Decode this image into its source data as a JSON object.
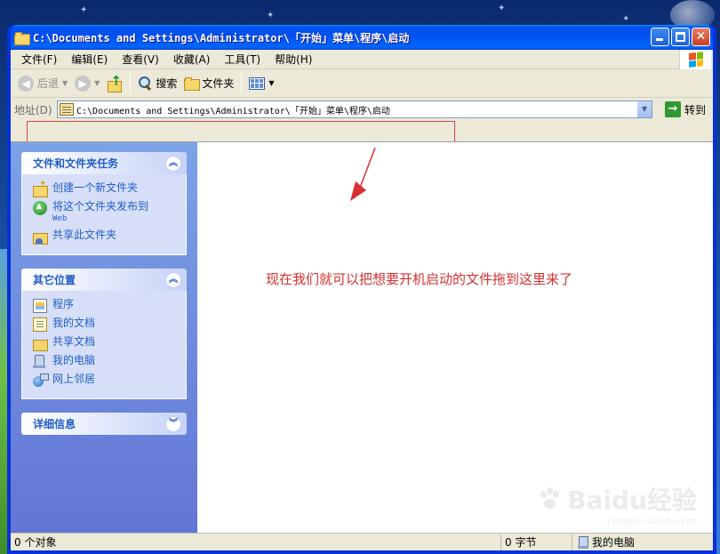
{
  "window": {
    "title": "C:\\Documents and Settings\\Administrator\\「开始」菜单\\程序\\启动"
  },
  "menu": [
    "文件(F)",
    "编辑(E)",
    "查看(V)",
    "收藏(A)",
    "工具(T)",
    "帮助(H)"
  ],
  "toolbar": {
    "back_label": "后退",
    "search_label": "搜索",
    "folders_label": "文件夹"
  },
  "address": {
    "label": "地址(D)",
    "value": "C:\\Documents and Settings\\Administrator\\「开始」菜单\\程序\\启动",
    "go_label": "转到"
  },
  "taskpane": {
    "file_tasks": {
      "title": "文件和文件夹任务",
      "items": [
        "创建一个新文件夹",
        "将这个文件夹发布到",
        "共享此文件夹"
      ],
      "web_suffix": "Web"
    },
    "other_places": {
      "title": "其它位置",
      "items": [
        "程序",
        "我的文档",
        "共享文档",
        "我的电脑",
        "网上邻居"
      ]
    },
    "details": {
      "title": "详细信息"
    }
  },
  "annotation": {
    "text": "现在我们就可以把想要开机启动的文件拖到这里来了",
    "color": "#d63030"
  },
  "statusbar": {
    "objects": "0 个对象",
    "size": "0 字节",
    "zone": "我的电脑"
  },
  "watermark": {
    "logo": "Baidu经验",
    "url": "jingyan.baidu.com"
  },
  "colors": {
    "titlebar": "#0053ee",
    "taskpane_link": "#215dc6",
    "chrome": "#ece9d8"
  }
}
